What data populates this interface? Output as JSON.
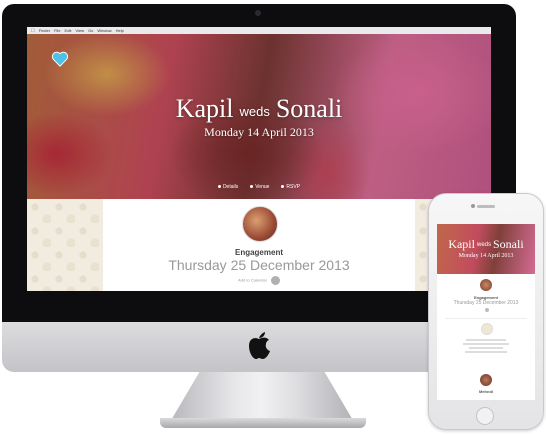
{
  "desktop": {
    "menubar": [
      "Finder",
      "File",
      "Edit",
      "View",
      "Go",
      "Window",
      "Help"
    ],
    "couple": {
      "name1": "Kapil",
      "connector": "weds",
      "name2": "Sonali"
    },
    "wedding_date": "Monday 14 April 2013",
    "nav": [
      "Details",
      "Venue",
      "RSVP"
    ],
    "event": {
      "title": "Engagement",
      "date": "Thursday 25 December 2013",
      "calendar_label": "Add to Calendar"
    }
  },
  "phone": {
    "couple": {
      "name1": "Kapil",
      "connector": "weds",
      "name2": "Sonali"
    },
    "wedding_date": "Monday 14 April 2013",
    "event": {
      "title": "Engagement",
      "date": "Thursday 25 December 2013"
    },
    "second_event_title": "Mehndi"
  },
  "colors": {
    "accent_heart": "#4fc1e9",
    "hero_pink": "#d46c94"
  }
}
